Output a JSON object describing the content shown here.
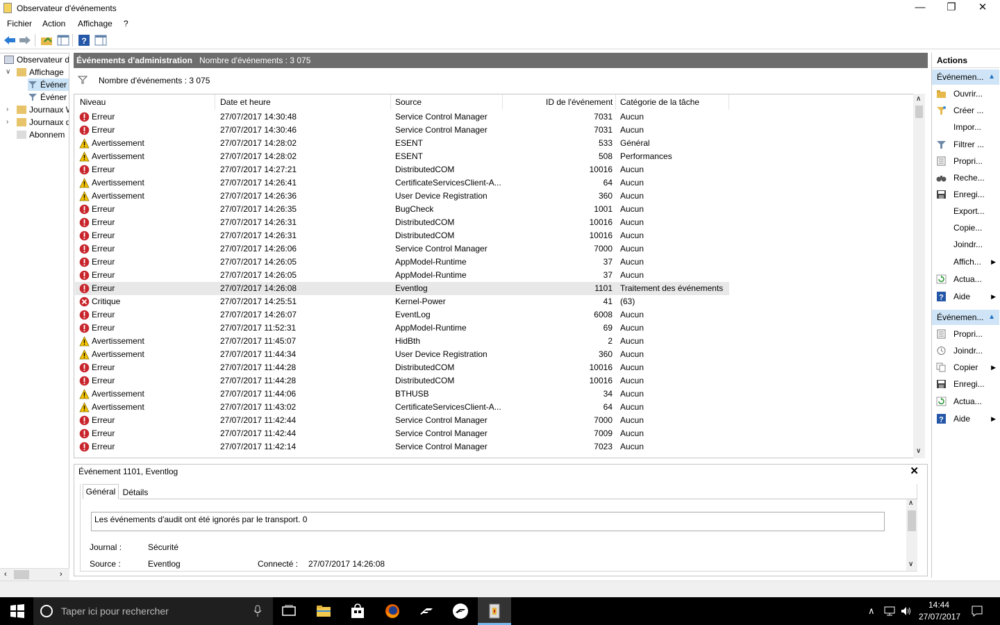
{
  "window": {
    "title": "Observateur d'événements"
  },
  "menu": [
    "Fichier",
    "Action",
    "Affichage",
    "?"
  ],
  "tree": {
    "items": [
      "Observateur d",
      "Affichage",
      "Événer",
      "Événer",
      "Journaux W",
      "Journaux d",
      "Abonnem"
    ]
  },
  "main": {
    "header_title": "Événements d'administration",
    "header_count": "Nombre d'événements : 3 075",
    "filter_count": "Nombre d'événements : 3 075",
    "columns": [
      "Niveau",
      "Date et heure",
      "Source",
      "ID de l'événement",
      "Catégorie de la tâche"
    ],
    "rows": [
      {
        "level": "Erreur",
        "date": "27/07/2017 14:30:48",
        "source": "Service Control Manager",
        "id": "7031",
        "cat": "Aucun"
      },
      {
        "level": "Erreur",
        "date": "27/07/2017 14:30:46",
        "source": "Service Control Manager",
        "id": "7031",
        "cat": "Aucun"
      },
      {
        "level": "Avertissement",
        "date": "27/07/2017 14:28:02",
        "source": "ESENT",
        "id": "533",
        "cat": "Général"
      },
      {
        "level": "Avertissement",
        "date": "27/07/2017 14:28:02",
        "source": "ESENT",
        "id": "508",
        "cat": "Performances"
      },
      {
        "level": "Erreur",
        "date": "27/07/2017 14:27:21",
        "source": "DistributedCOM",
        "id": "10016",
        "cat": "Aucun"
      },
      {
        "level": "Avertissement",
        "date": "27/07/2017 14:26:41",
        "source": "CertificateServicesClient-A...",
        "id": "64",
        "cat": "Aucun"
      },
      {
        "level": "Avertissement",
        "date": "27/07/2017 14:26:36",
        "source": "User Device Registration",
        "id": "360",
        "cat": "Aucun"
      },
      {
        "level": "Erreur",
        "date": "27/07/2017 14:26:35",
        "source": "BugCheck",
        "id": "1001",
        "cat": "Aucun"
      },
      {
        "level": "Erreur",
        "date": "27/07/2017 14:26:31",
        "source": "DistributedCOM",
        "id": "10016",
        "cat": "Aucun"
      },
      {
        "level": "Erreur",
        "date": "27/07/2017 14:26:31",
        "source": "DistributedCOM",
        "id": "10016",
        "cat": "Aucun"
      },
      {
        "level": "Erreur",
        "date": "27/07/2017 14:26:06",
        "source": "Service Control Manager",
        "id": "7000",
        "cat": "Aucun"
      },
      {
        "level": "Erreur",
        "date": "27/07/2017 14:26:05",
        "source": "AppModel-Runtime",
        "id": "37",
        "cat": "Aucun"
      },
      {
        "level": "Erreur",
        "date": "27/07/2017 14:26:05",
        "source": "AppModel-Runtime",
        "id": "37",
        "cat": "Aucun"
      },
      {
        "level": "Erreur",
        "date": "27/07/2017 14:26:08",
        "source": "Eventlog",
        "id": "1101",
        "cat": "Traitement des événements",
        "selected": true
      },
      {
        "level": "Critique",
        "date": "27/07/2017 14:25:51",
        "source": "Kernel-Power",
        "id": "41",
        "cat": "(63)"
      },
      {
        "level": "Erreur",
        "date": "27/07/2017 14:26:07",
        "source": "EventLog",
        "id": "6008",
        "cat": "Aucun"
      },
      {
        "level": "Erreur",
        "date": "27/07/2017 11:52:31",
        "source": "AppModel-Runtime",
        "id": "69",
        "cat": "Aucun"
      },
      {
        "level": "Avertissement",
        "date": "27/07/2017 11:45:07",
        "source": "HidBth",
        "id": "2",
        "cat": "Aucun"
      },
      {
        "level": "Avertissement",
        "date": "27/07/2017 11:44:34",
        "source": "User Device Registration",
        "id": "360",
        "cat": "Aucun"
      },
      {
        "level": "Erreur",
        "date": "27/07/2017 11:44:28",
        "source": "DistributedCOM",
        "id": "10016",
        "cat": "Aucun"
      },
      {
        "level": "Erreur",
        "date": "27/07/2017 11:44:28",
        "source": "DistributedCOM",
        "id": "10016",
        "cat": "Aucun"
      },
      {
        "level": "Avertissement",
        "date": "27/07/2017 11:44:06",
        "source": "BTHUSB",
        "id": "34",
        "cat": "Aucun"
      },
      {
        "level": "Avertissement",
        "date": "27/07/2017 11:43:02",
        "source": "CertificateServicesClient-A...",
        "id": "64",
        "cat": "Aucun"
      },
      {
        "level": "Erreur",
        "date": "27/07/2017 11:42:44",
        "source": "Service Control Manager",
        "id": "7000",
        "cat": "Aucun"
      },
      {
        "level": "Erreur",
        "date": "27/07/2017 11:42:44",
        "source": "Service Control Manager",
        "id": "7009",
        "cat": "Aucun"
      },
      {
        "level": "Erreur",
        "date": "27/07/2017 11:42:14",
        "source": "Service Control Manager",
        "id": "7023",
        "cat": "Aucun"
      }
    ]
  },
  "detail": {
    "title": "Événement 1101, Eventlog",
    "tabs": [
      "Général",
      "Détails"
    ],
    "message": "Les événements d'audit ont été ignorés par le transport. 0",
    "journal_label": "Journal :",
    "journal_value": "Sécurité",
    "source_label": "Source :",
    "source_value": "Eventlog",
    "logged_label": "Connecté :",
    "logged_value": "27/07/2017 14:26:08"
  },
  "actions": {
    "title": "Actions",
    "section1": "Événemen...",
    "items1": [
      {
        "label": "Ouvrir...",
        "icon": "folder-open-icon",
        "arrow": false
      },
      {
        "label": "Créer ...",
        "icon": "filter-create-icon",
        "arrow": false
      },
      {
        "label": "Impor...",
        "icon": "",
        "arrow": false
      },
      {
        "label": "Filtrer ...",
        "icon": "filter-icon",
        "arrow": false
      },
      {
        "label": "Propri...",
        "icon": "properties-icon",
        "arrow": false
      },
      {
        "label": "Reche...",
        "icon": "binoculars-icon",
        "arrow": false
      },
      {
        "label": "Enregi...",
        "icon": "save-icon",
        "arrow": false
      },
      {
        "label": "Export...",
        "icon": "",
        "arrow": false
      },
      {
        "label": "Copie...",
        "icon": "",
        "arrow": false
      },
      {
        "label": "Joindr...",
        "icon": "",
        "arrow": false
      },
      {
        "label": "Affich...",
        "icon": "",
        "arrow": true
      },
      {
        "label": "Actua...",
        "icon": "refresh-icon",
        "arrow": false
      },
      {
        "label": "Aide",
        "icon": "help-icon",
        "arrow": true
      }
    ],
    "section2": "Événemen...",
    "items2": [
      {
        "label": "Propri...",
        "icon": "properties-icon",
        "arrow": false
      },
      {
        "label": "Joindr...",
        "icon": "attach-task-icon",
        "arrow": false
      },
      {
        "label": "Copier",
        "icon": "copy-icon",
        "arrow": true
      },
      {
        "label": "Enregi...",
        "icon": "save-icon",
        "arrow": false
      },
      {
        "label": "Actua...",
        "icon": "refresh-icon",
        "arrow": false
      },
      {
        "label": "Aide",
        "icon": "help-icon",
        "arrow": true
      }
    ]
  },
  "taskbar": {
    "search_placeholder": "Taper ici pour rechercher",
    "time": "14:44",
    "date": "27/07/2017"
  },
  "colors": {
    "header": "#6d6d6d",
    "accent_blue": "#1c6fc4",
    "error_red": "#c8262c",
    "warning_yellow": "#f5c400",
    "section_blue": "#cfe4f6"
  }
}
